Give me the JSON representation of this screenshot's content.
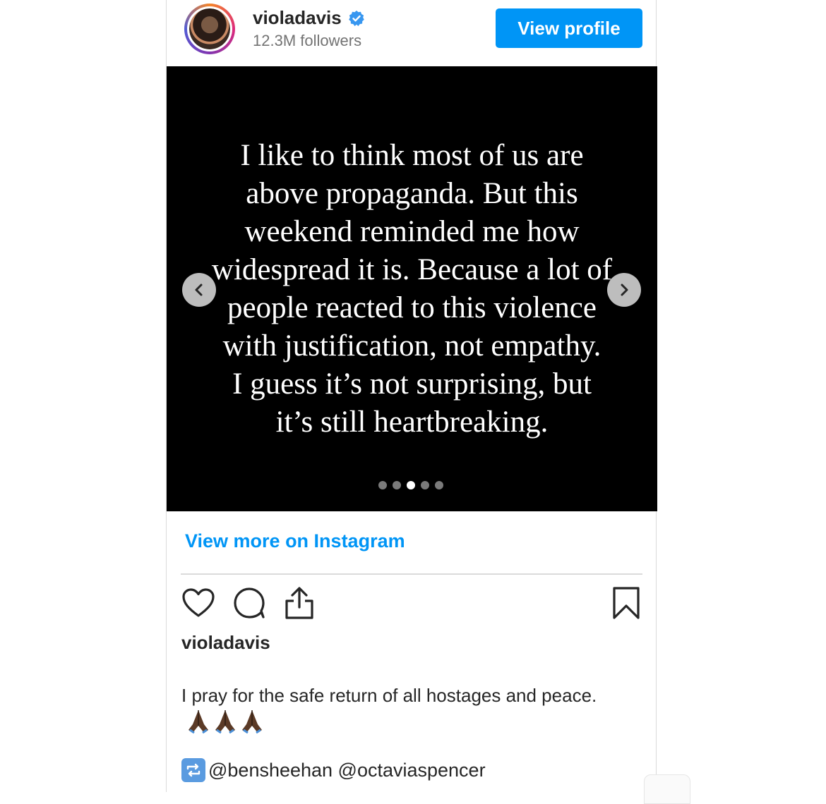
{
  "profile": {
    "username": "violadavis",
    "followers": "12.3M followers",
    "view_profile_label": "View profile"
  },
  "post": {
    "quote": "I like to think most of us are\nabove propaganda. But this\nweekend reminded me how\nwidespread it is. Because a lot of\npeople reacted to this violence\nwith justification, not empathy.\nI guess it’s not surprising, but\nit’s still heartbreaking.",
    "carousel": {
      "total": 5,
      "active_index": 3
    },
    "view_more_label": "View more on Instagram",
    "username": "violadavis",
    "caption": "I pray for the safe return of all hostages and peace.",
    "caption_emoji": "🙏🏿🙏🏿🙏🏿",
    "mentions": "@bensheehan @octaviaspencer"
  },
  "icons": [
    "verified-badge-icon",
    "chevron-left-icon",
    "chevron-right-icon",
    "heart-icon",
    "comment-icon",
    "share-icon",
    "bookmark-icon",
    "repost-icon",
    "praying-hands-icon"
  ],
  "colors": {
    "accent": "#0095f6",
    "media_bg": "#000000",
    "text": "#262626",
    "muted": "#737373"
  }
}
